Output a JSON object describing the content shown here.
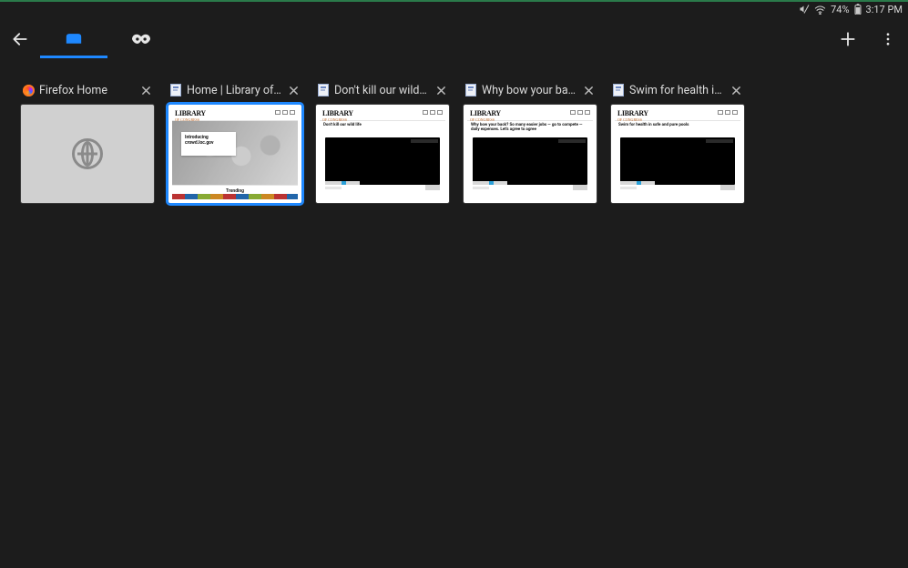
{
  "status": {
    "battery_pct": "74%",
    "time": "3:17 PM"
  },
  "toolbar": {
    "back_label": "Back",
    "normal_tabs_label": "Tabs",
    "private_tabs_label": "Private tabs",
    "new_tab_label": "New tab",
    "menu_label": "More options"
  },
  "tabs": [
    {
      "title": "Firefox Home",
      "favicon": "firefox",
      "selected": false,
      "kind": "blank"
    },
    {
      "title": "Home | Library of Congress",
      "favicon": "doc",
      "selected": true,
      "kind": "hero",
      "hero": {
        "line1": "Introducing",
        "line2": "crowd.loc.gov",
        "band": "Trending"
      }
    },
    {
      "title": "Don't kill our wild life",
      "favicon": "doc",
      "selected": false,
      "kind": "article",
      "article_title": "Don't kill our wild life"
    },
    {
      "title": "Why bow your back?",
      "favicon": "doc",
      "selected": false,
      "kind": "article",
      "article_title": "Why bow your back? So many easier jobs — go to compete — daily expenses. Let's agree to agree"
    },
    {
      "title": "Swim for health in safe and pure pools",
      "favicon": "doc",
      "selected": false,
      "kind": "article",
      "article_title": "Swim for health in safe and pure pools"
    }
  ]
}
